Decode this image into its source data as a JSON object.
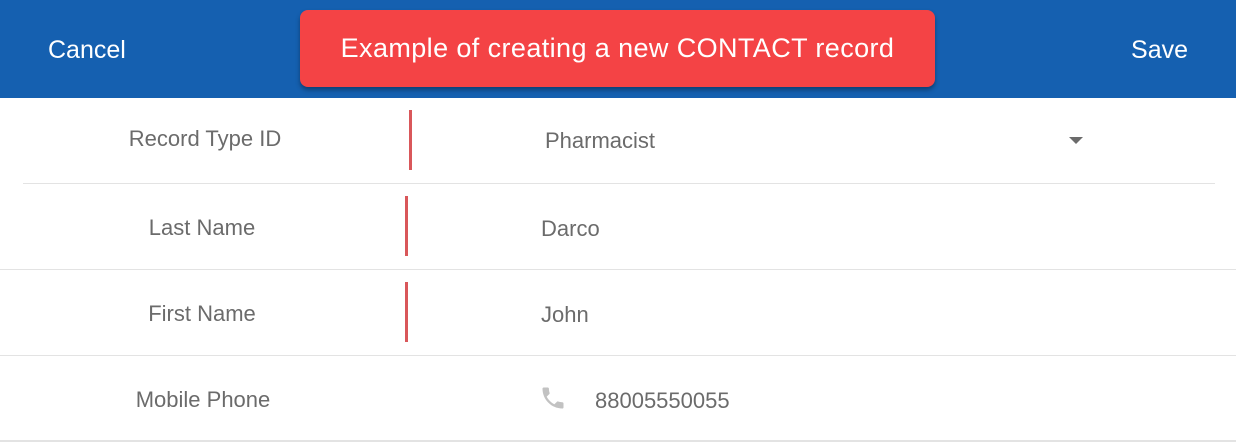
{
  "header": {
    "cancel_label": "Cancel",
    "save_label": "Save",
    "banner_text": "Example of creating a new CONTACT record"
  },
  "form": {
    "record_type": {
      "label": "Record Type ID",
      "value": "Pharmacist"
    },
    "last_name": {
      "label": "Last Name",
      "value": "Darco"
    },
    "first_name": {
      "label": "First Name",
      "value": "John"
    },
    "mobile_phone": {
      "label": "Mobile Phone",
      "value": "88005550055",
      "icon": "phone-icon"
    }
  },
  "colors": {
    "header_bg": "#1560b0",
    "banner_bg": "#f44345",
    "required_bar": "#d9575a",
    "text_gray": "#6b6b6b"
  }
}
